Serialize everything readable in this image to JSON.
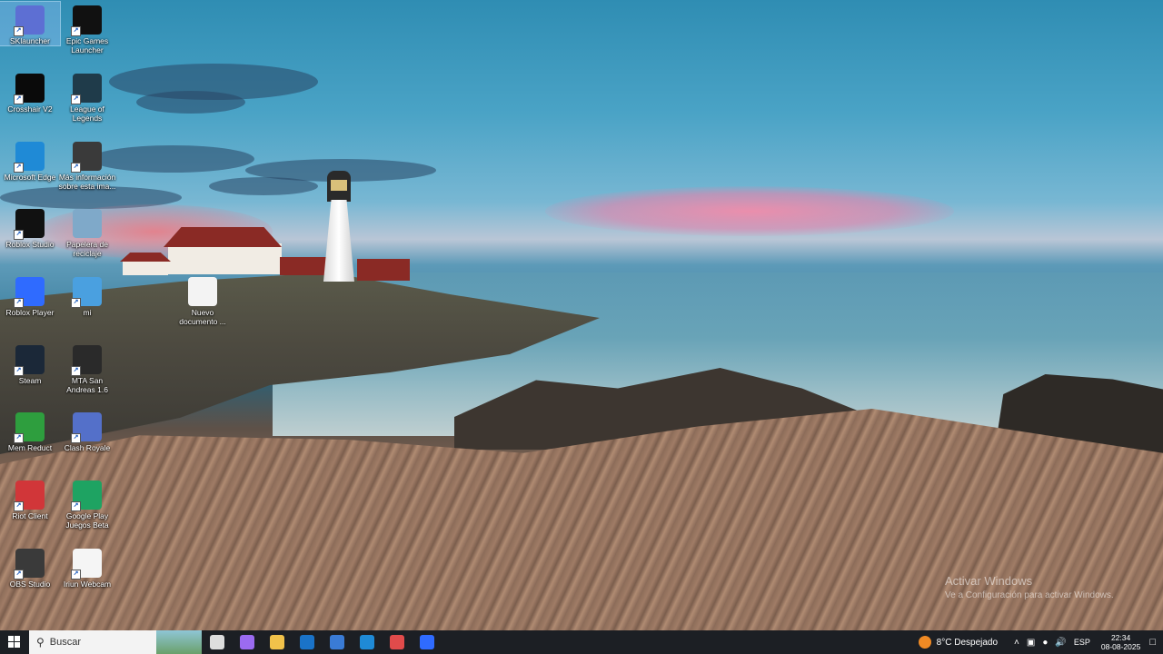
{
  "desktop_icons": [
    {
      "label": "SKlauncher",
      "icon": "sklauncher-icon",
      "color": "#5d6fd3"
    },
    {
      "label": "Epic Games Launcher",
      "icon": "epic-games-icon",
      "color": "#111111"
    },
    {
      "label": "Crosshair V2",
      "icon": "crosshair-icon",
      "color": "#0a0a0a"
    },
    {
      "label": "League of Legends",
      "icon": "league-of-legends-icon",
      "color": "#1f3b4a"
    },
    {
      "label": "Microsoft Edge",
      "icon": "edge-icon",
      "color": "#1f8ad6"
    },
    {
      "label": "Más información sobre esta ima...",
      "icon": "info-icon",
      "color": "#3a3a3a"
    },
    {
      "label": "Roblox Studio",
      "icon": "roblox-studio-icon",
      "color": "#111111"
    },
    {
      "label": "Papelera de reciclaje",
      "icon": "recycle-bin-icon",
      "color": "#7fa9c9"
    },
    {
      "label": "Roblox Player",
      "icon": "roblox-player-icon",
      "color": "#2f6bff"
    },
    {
      "label": "mi",
      "icon": "mi-icon",
      "color": "#4aa0e0"
    },
    {
      "label": "Nuevo documento ...",
      "icon": "text-document-icon",
      "color": "#f3f3f3"
    },
    {
      "label": "Steam",
      "icon": "steam-icon",
      "color": "#1b2838"
    },
    {
      "label": "MTA San Andreas 1.6",
      "icon": "mta-icon",
      "color": "#2a2a2a"
    },
    {
      "label": "Mem Reduct",
      "icon": "mem-reduct-icon",
      "color": "#2e9e3e"
    },
    {
      "label": "Clash Royale",
      "icon": "clash-royale-icon",
      "color": "#5470c9"
    },
    {
      "label": "Riot Client",
      "icon": "riot-client-icon",
      "color": "#d13639"
    },
    {
      "label": "Google Play Juegos Beta",
      "icon": "google-play-games-icon",
      "color": "#1ea362"
    },
    {
      "label": "OBS Studio",
      "icon": "obs-studio-icon",
      "color": "#3a3a3a"
    },
    {
      "label": "Iriun Webcam",
      "icon": "iriun-webcam-icon",
      "color": "#f5f5f5"
    }
  ],
  "watermark": {
    "line1": "Activar Windows",
    "line2": "Ve a Configuración para activar Windows."
  },
  "taskbar": {
    "search_label": "Buscar",
    "pinned": [
      {
        "name": "task-view-icon",
        "color": "#dddddd"
      },
      {
        "name": "copilot-icon",
        "color": "#9b6bf0"
      },
      {
        "name": "file-explorer-icon",
        "color": "#f1c24a"
      },
      {
        "name": "outlook-icon",
        "color": "#1a73c8"
      },
      {
        "name": "microsoft-store-icon",
        "color": "#3a7bd5"
      },
      {
        "name": "edge-icon",
        "color": "#1f8ad6"
      },
      {
        "name": "crosshair-icon",
        "color": "#e14b4b"
      },
      {
        "name": "roblox-icon",
        "color": "#2f6bff"
      }
    ],
    "weather_text": "8°C  Despejado",
    "language": "ESP",
    "time": "22:34",
    "date": "08-08-2025"
  }
}
